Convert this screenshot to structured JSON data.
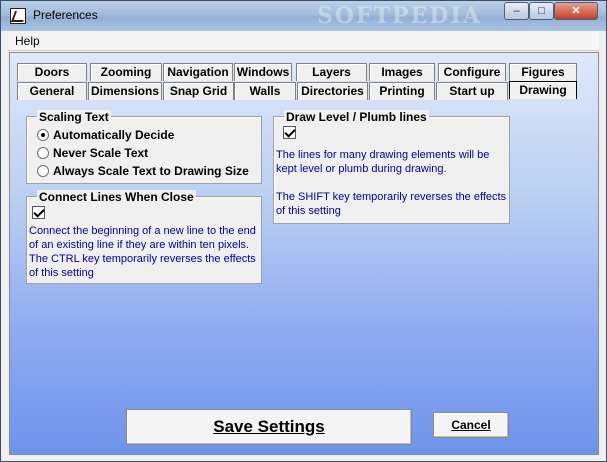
{
  "window": {
    "title": "Preferences",
    "watermark": "SOFTPEDIA",
    "controls": {
      "minimize": "–",
      "maximize": "□",
      "close": "✕"
    }
  },
  "menu": {
    "items": [
      "Help"
    ]
  },
  "tabs": {
    "row1": [
      "Doors",
      "Zooming",
      "Navigation",
      "Windows",
      "Layers",
      "Images",
      "Configure",
      "Figures"
    ],
    "row2": [
      "General",
      "Dimensions",
      "Snap Grid",
      "Walls",
      "Directories",
      "Printing",
      "Start up",
      "Drawing"
    ],
    "active": "Drawing"
  },
  "scaling_text": {
    "title": "Scaling Text",
    "options": [
      {
        "label": "Automatically  Decide",
        "checked": true
      },
      {
        "label": "Never Scale Text",
        "checked": false
      },
      {
        "label": "Always Scale Text to Drawing Size",
        "checked": false
      }
    ]
  },
  "connect_lines": {
    "title": "Connect Lines When Close",
    "checked": true,
    "description": "Connect the beginning of a new line to the end\nof an existing line if they are within ten pixels.\nThe CTRL key temporarily reverses the effects\nof this setting"
  },
  "draw_level": {
    "title": "Draw Level / Plumb lines",
    "checked": true,
    "description": "The lines for many drawing elements will be\nkept level or plumb during drawing.\n\nThe SHIFT key temporarily reverses the effects\nof this setting"
  },
  "buttons": {
    "save": "Save Settings",
    "cancel": "Cancel"
  },
  "colors": {
    "description_text": "#0000a0",
    "gradient_top": "#dfe9fa",
    "gradient_bottom": "#6f93ec"
  }
}
